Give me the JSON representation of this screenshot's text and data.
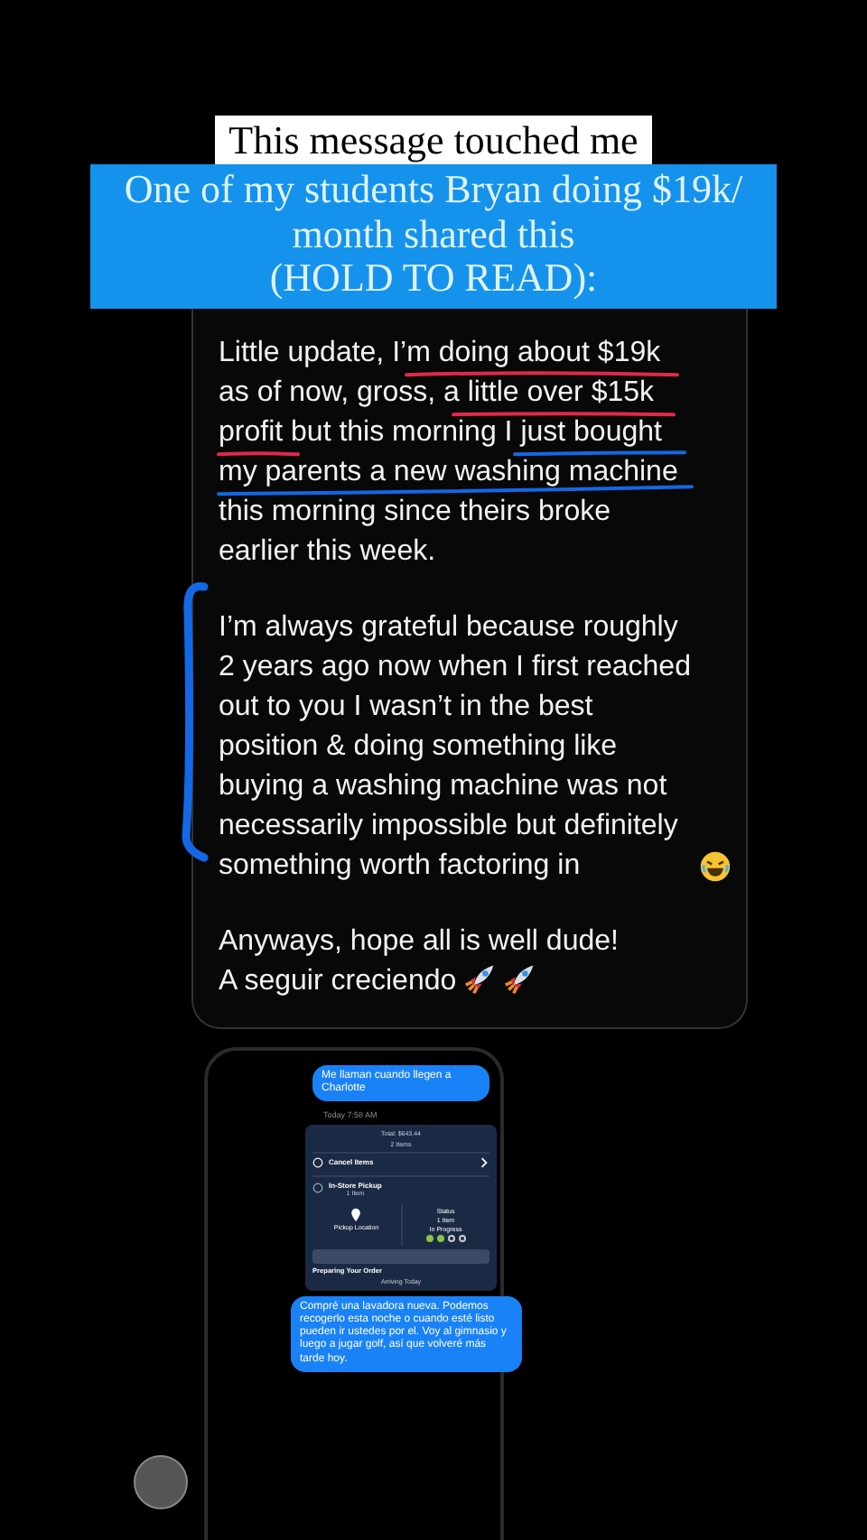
{
  "caption": {
    "title": "This message touched me",
    "subtitle": [
      "One of my students Bryan doing $19k/",
      "month shared this",
      "(HOLD TO READ):"
    ]
  },
  "message": {
    "paragraphs": [
      "Little update, I’m doing about $19k as of now, gross, a little over $15k profit but this morning I just bought my parents a new washing machine this morning since theirs broke earlier this week.",
      "I’m always grateful because roughly 2 years ago now when I first reached out to you I wasn’t in the best position & doing something like buying a washing machine was not necessarily impossible but definitely something worth factoring in",
      "Anyways, hope all is well dude!",
      "A seguir creciendo"
    ]
  },
  "chat": {
    "sent_top": "Me llaman cuando llegen a Charlotte",
    "timestamp": "Today 7:58 AM",
    "order": {
      "total": "Total: $643.44",
      "count": "2 Items",
      "cancel": "Cancel Items",
      "pickup": "In-Store Pickup",
      "pickup_count": "1 Item",
      "location_label": "Pickup Location",
      "status_label": "Status",
      "status_count": "1 Item",
      "status": "In Progress",
      "level": 0.5,
      "preparing": "Preparing Your Order",
      "arriving": "Arriving Today"
    },
    "sent_bottom": "Compré una lavadora nueva. Podemos recogerlo esta noche o cuando esté listo pueden ir ustedes por el. Voy al gimnasio y luego a jugar golf, así que volveré más tarde hoy."
  }
}
